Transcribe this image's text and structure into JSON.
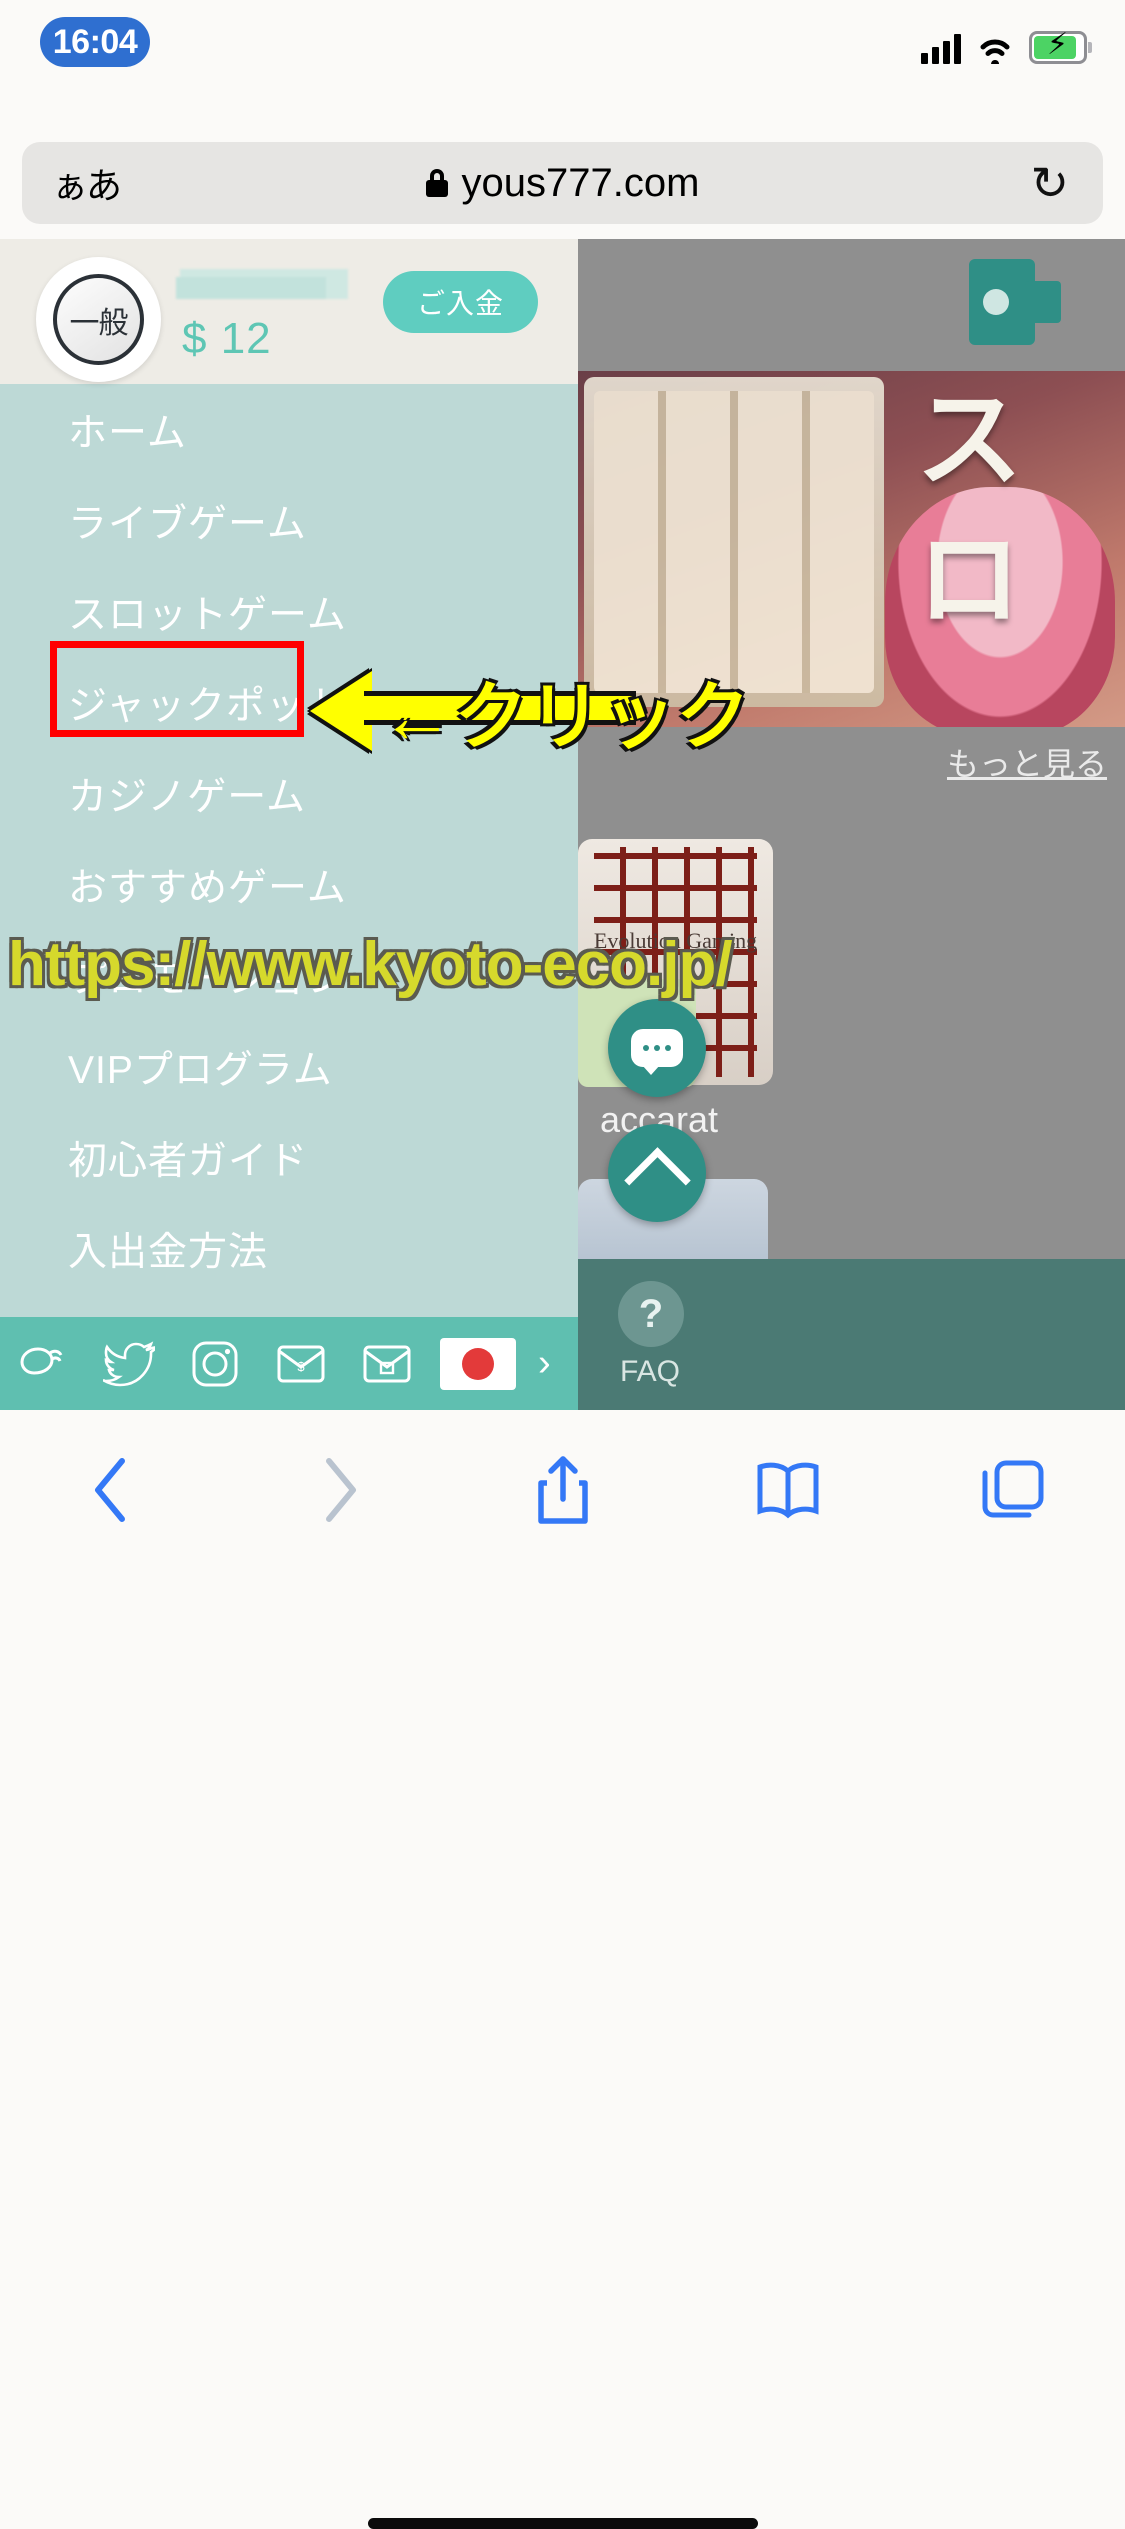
{
  "status_bar": {
    "time": "16:04",
    "icons": [
      "cellular-signal-icon",
      "wifi-icon",
      "battery-charging-icon"
    ]
  },
  "browser": {
    "text_size_button": "ぁあ",
    "lock_icon": "lock-icon",
    "url": "yous777.com",
    "reload_icon": "reload-icon",
    "bottom_toolbar": {
      "back": "‹",
      "forward": "›",
      "share": "share-icon",
      "bookmarks": "book-icon",
      "tabs": "tabs-icon"
    }
  },
  "account": {
    "avatar_rank": "一般",
    "username_masked": "",
    "balance": "$ 12",
    "deposit_label": "ご入金"
  },
  "menu": {
    "items": [
      {
        "label": "ホーム"
      },
      {
        "label": "ライブゲーム"
      },
      {
        "label": "スロットゲーム"
      },
      {
        "label": "ジャックポット"
      },
      {
        "label": "カジノゲーム"
      },
      {
        "label": "おすすめゲーム"
      },
      {
        "label": "プロモーション"
      },
      {
        "label": "VIPプログラム"
      },
      {
        "label": "初心者ガイド"
      },
      {
        "label": "入出金方法"
      }
    ],
    "highlighted_index": 2,
    "highlight_color": "#ff0000"
  },
  "annotation": {
    "arrow_label": "←クリック",
    "arrow_color": "#ffff00",
    "watermark_url": "https://www.kyoto-eco.jp/",
    "watermark_color": "#d6d92c"
  },
  "social_bar": {
    "icons": [
      "line-icon",
      "twitter-icon",
      "instagram-icon",
      "mail-icon",
      "mail-lock-icon"
    ],
    "flag": "japan-flag-icon",
    "more": "›"
  },
  "background_site": {
    "wallet_icon": "wallet-icon",
    "more_link": "もっと見る",
    "card_label": "Evolution Gaming",
    "baccarat_label": "accarat",
    "faq_label": "FAQ",
    "faq_icon": "question-icon",
    "chat_icon": "chat-bubble-icon",
    "scroll_top_icon": "chevron-up-icon",
    "slot_text": "ス ロ"
  },
  "colors": {
    "drawer_bg": "#bdd9d6",
    "teal": "#5fcdc0",
    "balance": "#5ec6b4",
    "social_bar": "#5fbfb0"
  }
}
